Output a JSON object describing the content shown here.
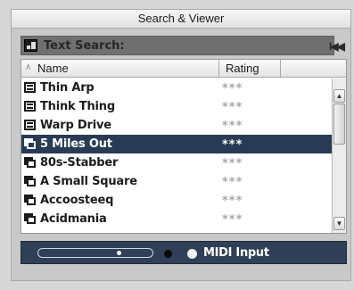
{
  "window": {
    "title": "Search & Viewer"
  },
  "search": {
    "label": "Text Search:",
    "nav_first": "I◀◀"
  },
  "list": {
    "columns": {
      "name": "Name",
      "rating": "Rating",
      "sort_indicator": "∧"
    },
    "rows": [
      {
        "name": "Thin Arp",
        "rating": "***",
        "icon": "list-icon",
        "selected": false
      },
      {
        "name": "Think Thing",
        "rating": "***",
        "icon": "list-icon",
        "selected": false
      },
      {
        "name": "Warp Drive",
        "rating": "***",
        "icon": "list-icon",
        "selected": false
      },
      {
        "name": "5 Miles Out",
        "rating": "***",
        "icon": "window-icon",
        "selected": true
      },
      {
        "name": "80s-Stabber",
        "rating": "***",
        "icon": "window-icon",
        "selected": false
      },
      {
        "name": "A Small Square",
        "rating": "***",
        "icon": "window-icon",
        "selected": false
      },
      {
        "name": "Accoosteeq",
        "rating": "***",
        "icon": "window-icon",
        "selected": false
      },
      {
        "name": "Acidmania",
        "rating": "***",
        "icon": "window-icon",
        "selected": false
      }
    ]
  },
  "scroll": {
    "up": "▲",
    "down": "▼"
  },
  "footer": {
    "midi_label": "MIDI Input",
    "slider_position": 0.72
  },
  "colors": {
    "selected_row": "#283b55",
    "footer_bg": "#2f3f57",
    "rating_dim": "#a8a8a8"
  }
}
